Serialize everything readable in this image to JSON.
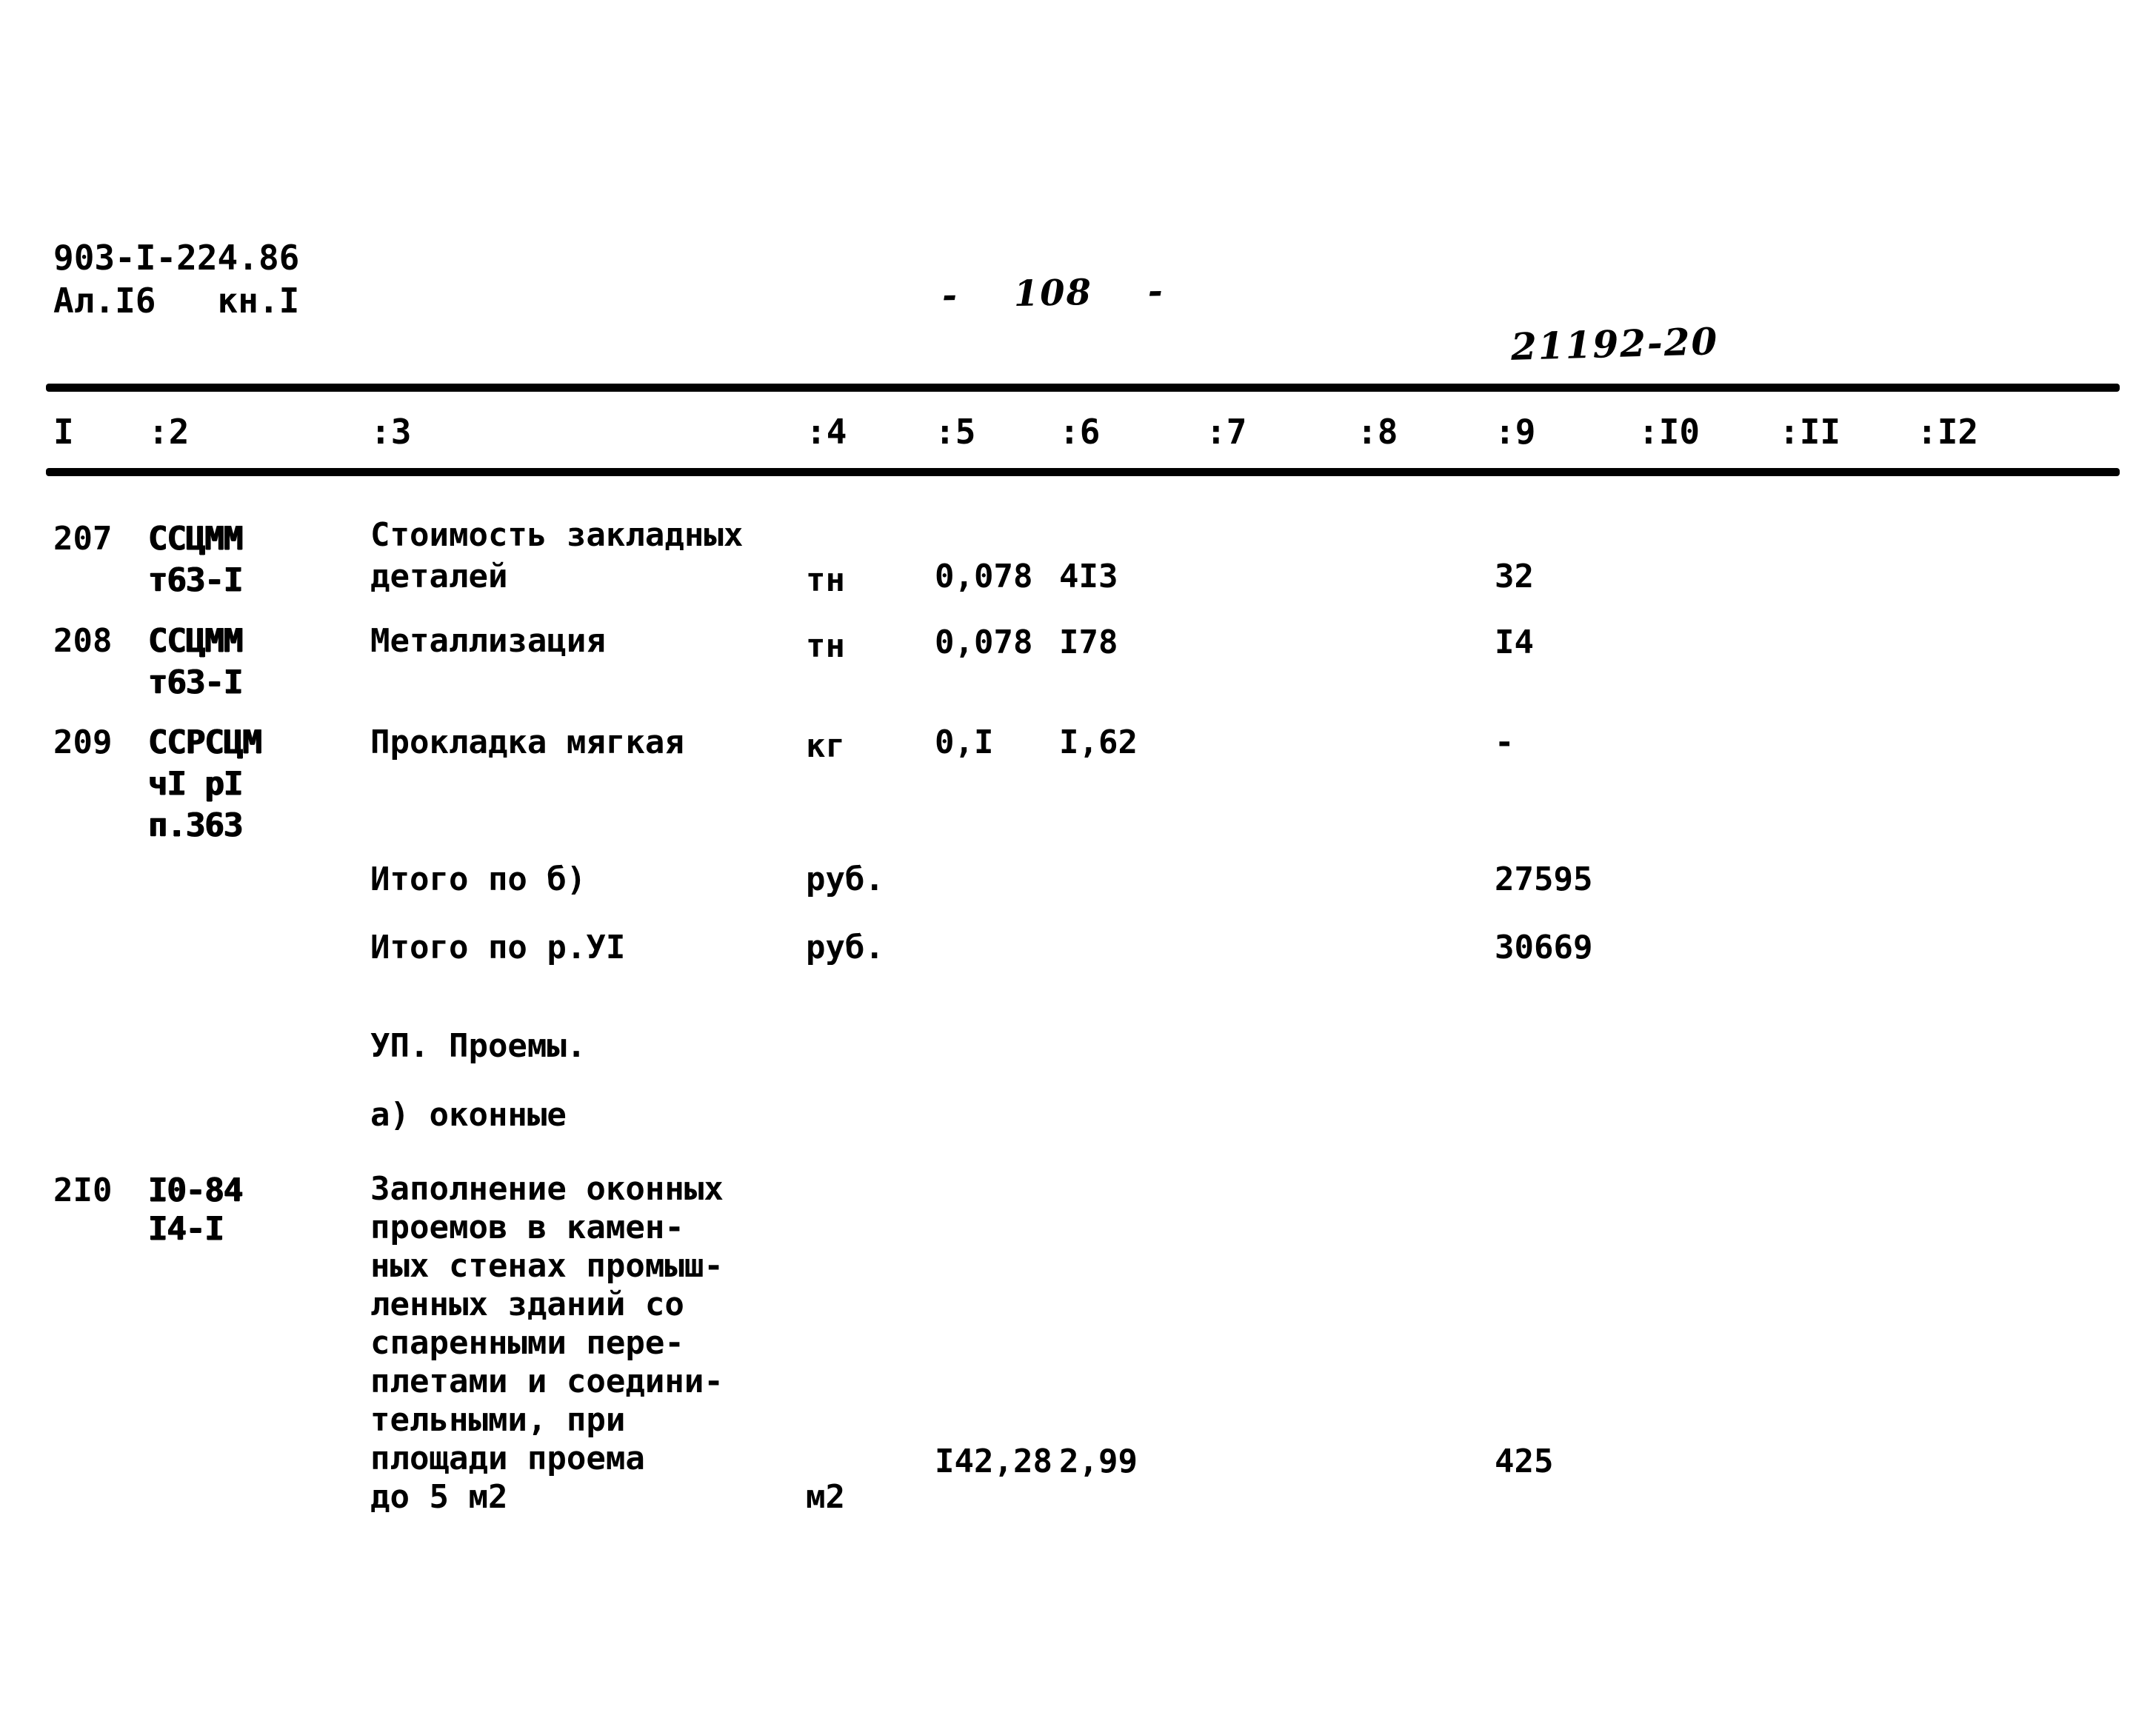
{
  "document": {
    "code_line1": "903-I-224.86",
    "code_line2": "Ал.I6   кн.I",
    "page_number": "-    108    -",
    "archive_stamp": "21192-20"
  },
  "table": {
    "column_headers": [
      "I",
      ":2",
      ":3",
      ":4",
      ":5",
      ":6",
      ":7",
      ":8",
      ":9",
      ":I0",
      ":II",
      ":I2"
    ],
    "rows": [
      {
        "num": "207",
        "code_line1": "ССЦММ",
        "code_line2": "т63-I",
        "desc_line1": "Стоимость закладных",
        "desc_line2": "деталей",
        "unit": "тн",
        "qty": "0,078",
        "price": "4I3",
        "total": "32"
      },
      {
        "num": "208",
        "code_line1": "ССЦММ",
        "code_line2": "т63-I",
        "desc_line1": "Металлизация",
        "desc_line2": "",
        "unit": "тн",
        "qty": "0,078",
        "price": "I78",
        "total": "I4"
      },
      {
        "num": "209",
        "code_line1": "ССРСЦМ",
        "code_line2": "чI рI",
        "code_line3": "п.363",
        "desc_line1": "Прокладка мягкая",
        "unit": "кг",
        "qty": "0,I",
        "price": "I,62",
        "total": "-"
      }
    ],
    "subtotals": [
      {
        "label": "Итого по б)",
        "unit": "руб.",
        "total": "27595"
      },
      {
        "label": "Итого по р.УI",
        "unit": "руб.",
        "total": "30669"
      }
    ],
    "section": {
      "heading": "УП. Проемы.",
      "subheading": "а) оконные"
    },
    "last_row": {
      "num": "2I0",
      "code_line1": "I0-84",
      "code_line2": "I4-I",
      "desc_lines": [
        "Заполнение оконных",
        "проемов в камен-",
        "ных стенах промыш-",
        "ленных зданий со",
        "спаренными пере-",
        "плетами и соедини-",
        "тельными, при",
        "площади проема",
        "до 5 м2"
      ],
      "unit": "м2",
      "qty": "I42,28",
      "price": "2,99",
      "total": "425"
    }
  }
}
